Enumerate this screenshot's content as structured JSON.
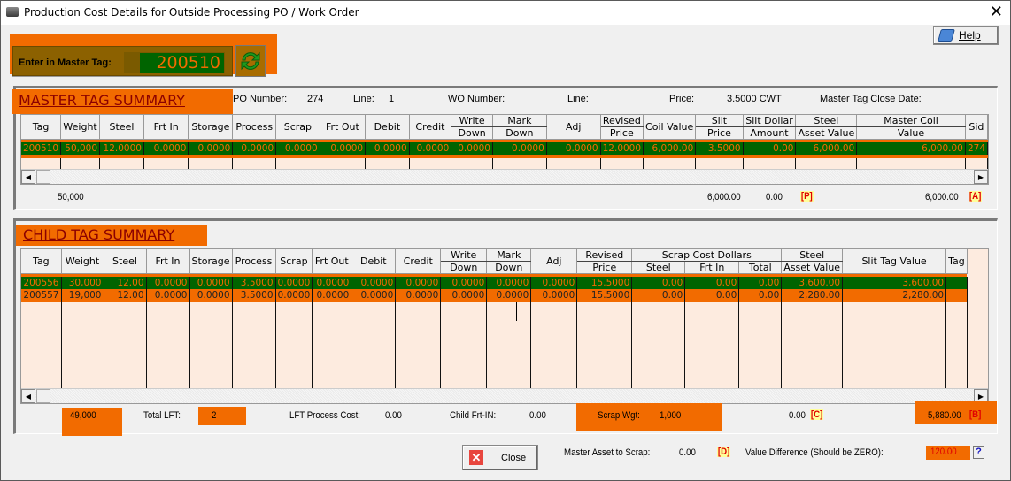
{
  "window": {
    "title": "Production Cost Details for Outside Processing PO / Work Order",
    "close_glyph": "✕"
  },
  "tag_entry": {
    "label": "Enter in Master Tag:",
    "value": "200510"
  },
  "help_button": {
    "label": "Help"
  },
  "master": {
    "title": "MASTER TAG SUMMARY",
    "po_label": "PO Number:",
    "po_value": "274",
    "line_label": "Line:",
    "line_value": "1",
    "wo_label": "WO Number:",
    "wo_value": "",
    "wo_line_label": "Line:",
    "wo_line_value": "",
    "price_label": "Price:",
    "price_value": "3.5000  CWT",
    "close_date_label": "Master Tag Close Date:",
    "close_date_value": "",
    "columns": [
      {
        "top": "Tag",
        "bottom": ""
      },
      {
        "top": "Weight",
        "bottom": ""
      },
      {
        "top": "Steel",
        "bottom": ""
      },
      {
        "top": "Frt In",
        "bottom": ""
      },
      {
        "top": "Storage",
        "bottom": ""
      },
      {
        "top": "Process",
        "bottom": ""
      },
      {
        "top": "Scrap",
        "bottom": ""
      },
      {
        "top": "Frt Out",
        "bottom": ""
      },
      {
        "top": "Debit",
        "bottom": ""
      },
      {
        "top": "Credit",
        "bottom": ""
      },
      {
        "top": "Write",
        "bottom": "Down"
      },
      {
        "top": "Mark",
        "bottom": "Down"
      },
      {
        "top": "Adj",
        "bottom": ""
      },
      {
        "top": "Revised",
        "bottom": "Price"
      },
      {
        "top": "Coil Value",
        "bottom": ""
      },
      {
        "top": "Slit",
        "bottom": "Price"
      },
      {
        "top": "Slit Dollar",
        "bottom": "Amount"
      },
      {
        "top": "Steel",
        "bottom": "Asset Value"
      },
      {
        "top": "Master Coil",
        "bottom": "Value"
      },
      {
        "top": "Sid",
        "bottom": ""
      }
    ],
    "rows": [
      [
        "200510",
        "50,000",
        "12.0000",
        "0.0000",
        "0.0000",
        "0.0000",
        "0.0000",
        "0.0000",
        "0.0000",
        "0.0000",
        "0.0000",
        "0.0000",
        "0.0000",
        "12.0000",
        "6,000.00",
        "3.5000",
        "0.00",
        "6,000.00",
        "6,000.00",
        "274"
      ]
    ],
    "totals": {
      "weight": "50,000",
      "coil_value": "6,000.00",
      "slit_dollar": "0.00",
      "marker_p": "[P]",
      "master_coil_value": "6,000.00",
      "marker_a": "[A]"
    }
  },
  "child": {
    "title": "CHILD TAG SUMMARY",
    "group_header": "Scrap Cost Dollars",
    "columns": [
      {
        "top": "Tag",
        "bottom": ""
      },
      {
        "top": "Weight",
        "bottom": ""
      },
      {
        "top": "Steel",
        "bottom": ""
      },
      {
        "top": "Frt In",
        "bottom": ""
      },
      {
        "top": "Storage",
        "bottom": ""
      },
      {
        "top": "Process",
        "bottom": ""
      },
      {
        "top": "Scrap",
        "bottom": ""
      },
      {
        "top": "Frt Out",
        "bottom": ""
      },
      {
        "top": "Debit",
        "bottom": ""
      },
      {
        "top": "Credit",
        "bottom": ""
      },
      {
        "top": "Write",
        "bottom": "Down"
      },
      {
        "top": "Mark",
        "bottom": "Down"
      },
      {
        "top": "Adj",
        "bottom": ""
      },
      {
        "top": "Revised",
        "bottom": "Price"
      },
      {
        "top": "",
        "bottom": "Steel"
      },
      {
        "top": "",
        "bottom": "Frt In"
      },
      {
        "top": "",
        "bottom": "Total"
      },
      {
        "top": "Steel",
        "bottom": "Asset Value"
      },
      {
        "top": "Slit Tag Value",
        "bottom": ""
      },
      {
        "top": "Tag",
        "bottom": ""
      }
    ],
    "rows": [
      [
        "200556",
        "30,000",
        "12.00",
        "0.0000",
        "0.0000",
        "3.5000",
        "0.0000",
        "0.0000",
        "0.0000",
        "0.0000",
        "0.0000",
        "0.0000",
        "0.0000",
        "15.5000",
        "0.00",
        "0.00",
        "0.00",
        "3,600.00",
        "3,600.00",
        ""
      ],
      [
        "200557",
        "19,000",
        "12.00",
        "0.0000",
        "0.0000",
        "3.5000",
        "0.0000",
        "0.0000",
        "0.0000",
        "0.0000",
        "0.0000",
        "0.0000",
        "0.0000",
        "15.5000",
        "0.00",
        "0.00",
        "0.00",
        "2,280.00",
        "2,280.00",
        ""
      ]
    ],
    "totals": {
      "weight": "49,000",
      "total_lft_label": "Total LFT:",
      "total_lft_value": "2",
      "lft_process_cost_label": "LFT Process Cost:",
      "lft_process_cost_value": "0.00",
      "child_frt_in_label": "Child Frt-IN:",
      "child_frt_in_value": "0.00",
      "scrap_wgt_label": "Scrap Wgt:",
      "scrap_wgt_value": "1,000",
      "scrap_total": "0.00",
      "marker_c": "[C]",
      "slit_tag_total": "5,880.00",
      "marker_b": "[B]"
    }
  },
  "footer": {
    "close_label": "Close",
    "master_asset_scrap_label": "Master Asset to Scrap:",
    "master_asset_scrap_value": "0.00",
    "marker_d": "[D]",
    "value_diff_label": "Value Difference (Should be ZERO):",
    "value_diff_value": "120.00",
    "help_q": "?"
  },
  "colors": {
    "highlight_orange": "#f26b00",
    "selected_green": "#006400",
    "grid_bg": "#fdebdf",
    "title_red": "#8b0000",
    "marker_red": "#e00000"
  }
}
